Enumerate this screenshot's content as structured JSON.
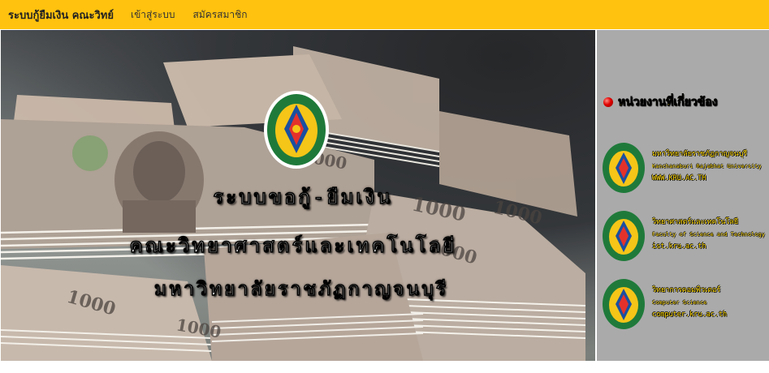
{
  "navbar": {
    "brand": "ระบบกู้ยืมเงิน คณะวิทย์",
    "links": [
      "เข้าสู่ระบบ",
      "สมัครสมาชิก"
    ]
  },
  "hero": {
    "line1": "ระบบขอกู้-ยืมเงิน",
    "line2": "คณะวิทยาศาสตร์และเทคโนโลยี",
    "line3": "มหาวิทยาลัยราชภัฏกาญจนบุรี",
    "banknote_value": "1000",
    "icons": [
      "university-seal-icon"
    ]
  },
  "sidebar": {
    "title": "หน่วยงานที่เกี่ยวข้อง",
    "agencies": [
      {
        "name_th": "มหาวิทยาลัยราชภัฏกาญจนบุรี",
        "name_en": "Kanchanaburi Rajabhat University",
        "url": "WWW.KRU.AC.TH"
      },
      {
        "name_th": "วิทยาศาสตร์และเทคโนโลยี",
        "name_en": "Faculty of Science and Technology",
        "url": "ist.kru.ac.th"
      },
      {
        "name_th": "วิทยาการคอมพิวเตอร์",
        "name_en": "Computer Science",
        "url": "computer.kru.ac.th"
      }
    ]
  },
  "colors": {
    "navbar": "#ffc20e",
    "sidebar": "#aaaaaa",
    "sidebar_text": "#ffd700",
    "bullet": "#e00000"
  }
}
